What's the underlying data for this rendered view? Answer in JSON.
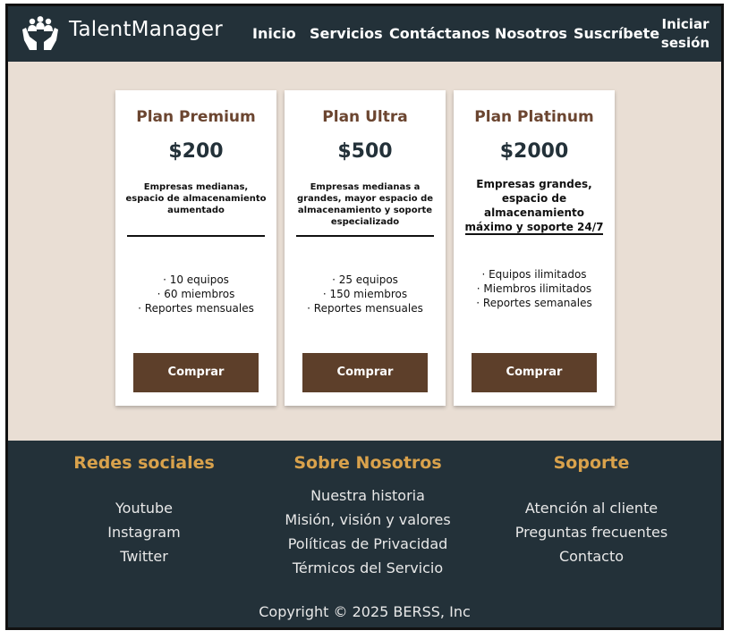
{
  "header": {
    "brand": "TalentManager",
    "nav": [
      "Inicio",
      "Servicios",
      "Contáctanos",
      "Nosotros",
      "Suscríbete"
    ],
    "login_line1": "Iniciar",
    "login_line2": "sesión"
  },
  "plans": [
    {
      "name": "Plan Premium",
      "price": "$200",
      "description": "Empresas medianas, espacio de almacenamiento aumentado",
      "features": [
        "· 10 equipos",
        "· 60 miembros",
        "· Reportes mensuales"
      ],
      "button": "Comprar"
    },
    {
      "name": "Plan Ultra",
      "price": "$500",
      "description": "Empresas medianas a grandes, mayor espacio de almacenamiento y soporte especializado",
      "features": [
        "· 25 equipos",
        "· 150 miembros",
        "· Reportes mensuales"
      ],
      "button": "Comprar"
    },
    {
      "name": "Plan Platinum",
      "price": "$2000",
      "description": "Empresas grandes, espacio de almacenamiento máximo y soporte 24/7",
      "features": [
        "· Equipos ilimitados",
        "· Miembros ilimitados",
        "· Reportes semanales"
      ],
      "button": "Comprar"
    }
  ],
  "footer": {
    "social": {
      "title": "Redes sociales",
      "links": [
        "Youtube",
        "Instagram",
        "Twitter"
      ]
    },
    "about": {
      "title": "Sobre Nosotros",
      "links": [
        "Nuestra historia",
        "Misión, visión y valores",
        "Políticas de Privacidad",
        "Térmicos del Servicio"
      ]
    },
    "support": {
      "title": "Soporte",
      "links": [
        "Atención al cliente",
        "Preguntas frecuentes",
        "Contacto"
      ]
    },
    "copyright": "Copyright © 2025 BERSS, Inc"
  },
  "colors": {
    "header_bg": "#233139",
    "page_bg": "#e9ded4",
    "accent_brown": "#5d3f2a",
    "plan_title": "#6b4530",
    "footer_heading": "#d9a24c"
  },
  "icons": {
    "logo": "hands-holding-people-icon"
  }
}
